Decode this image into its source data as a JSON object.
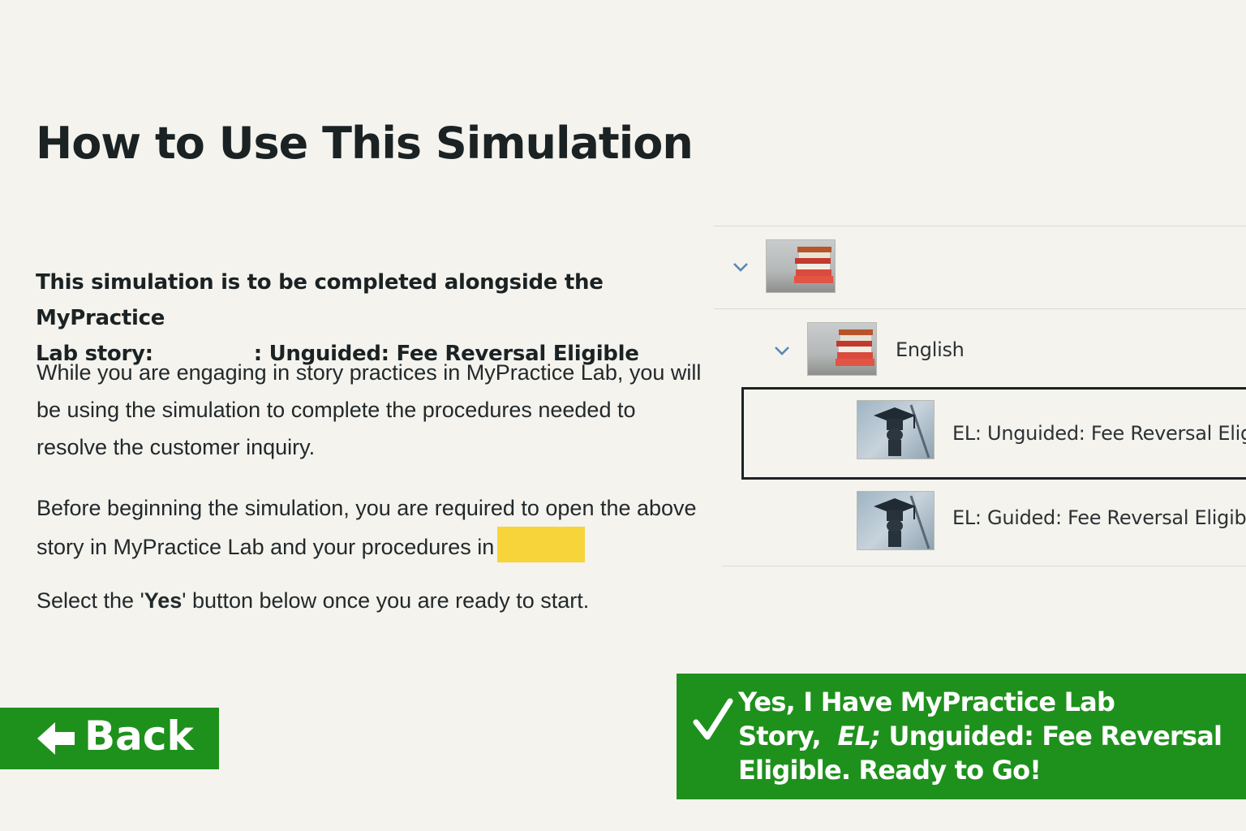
{
  "page": {
    "title": "How to Use This Simulation"
  },
  "intro": {
    "line1": "This simulation is to be completed alongside the MyPractice",
    "line2_prefix": "Lab story:",
    "line2_suffix": ": Unguided: Fee Reversal Eligible"
  },
  "paragraphs": {
    "p1": "While you are engaging in story practices in MyPractice Lab, you will be using the simulation to complete the procedures needed to resolve the customer inquiry.",
    "p2": "Before beginning the simulation, you are required to open the above story in MyPractice Lab and your procedures in",
    "p3_before": "Select the '",
    "p3_bold": "Yes",
    "p3_after": "' button below once you are ready to start."
  },
  "tree": {
    "items": [
      {
        "level": 0,
        "label": "",
        "icon": "books-icon",
        "expanded": true
      },
      {
        "level": 1,
        "label": "English",
        "icon": "books-icon",
        "expanded": true
      },
      {
        "level": 2,
        "label": "EL: Unguided: Fee Reversal Eligib",
        "icon": "graduation-cap-icon",
        "selected": true
      },
      {
        "level": 2,
        "label": "EL: Guided: Fee Reversal Eligible",
        "icon": "graduation-cap-icon",
        "selected": false
      }
    ]
  },
  "buttons": {
    "back_label": "Back",
    "back_icon": "arrow-left-icon",
    "yes_line_a": "Yes, I Have MyPractice Lab Story,",
    "yes_em": "EL;",
    "yes_line_b": "Unguided: Fee Reversal Eligible. Ready to Go!",
    "yes_icon": "checkmark-icon"
  },
  "colors": {
    "background": "#f4f3ee",
    "button_green": "#1e911c",
    "highlight_yellow": "#f7d43a",
    "chevron_blue": "#5a87b6"
  }
}
